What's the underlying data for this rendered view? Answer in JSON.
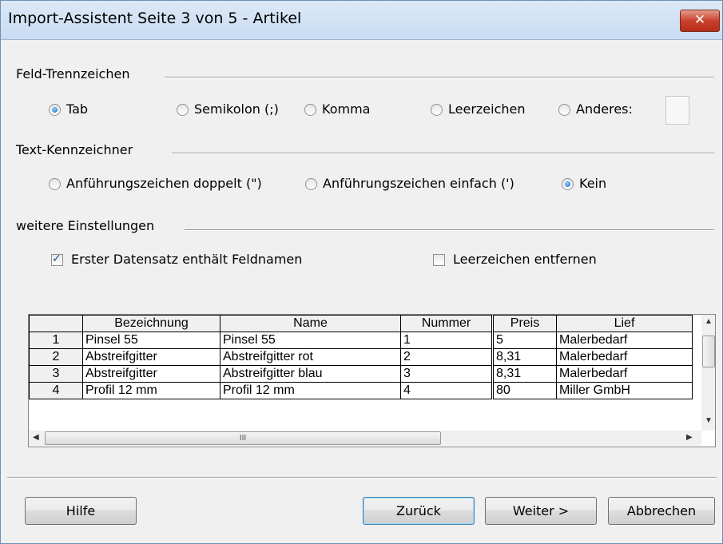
{
  "window": {
    "title": "Import-Assistent Seite 3 von 5 - Artikel",
    "close_icon": "close-icon"
  },
  "field_separator": {
    "label": "Feld-Trennzeichen",
    "options": [
      "Tab",
      "Semikolon (;)",
      "Komma",
      "Leerzeichen",
      "Anderes:"
    ],
    "selected": "Tab",
    "other_value": ""
  },
  "text_qualifier": {
    "label": "Text-Kennzeichner",
    "options": [
      "Anführungszeichen doppelt (\")",
      "Anführungszeichen einfach (')",
      "Kein"
    ],
    "selected": "Kein"
  },
  "more_settings": {
    "label": "weitere Einstellungen",
    "first_row_names": {
      "label": "Erster Datensatz enthält Feldnamen",
      "checked": true
    },
    "trim_spaces": {
      "label": "Leerzeichen entfernen",
      "checked": false
    }
  },
  "preview": {
    "columns": [
      "",
      "Bezeichnung",
      "Name",
      "Nummer",
      "Preis",
      "Lief"
    ],
    "rows": [
      [
        "1",
        "Pinsel 55",
        "Pinsel 55",
        "1",
        "5",
        "Malerbedarf"
      ],
      [
        "2",
        "Abstreifgitter",
        "Abstreifgitter rot",
        "2",
        "8,31",
        "Malerbedarf"
      ],
      [
        "3",
        "Abstreifgitter",
        "Abstreifgitter blau",
        "3",
        "8,31",
        "Malerbedarf"
      ],
      [
        "4",
        "Profil 12 mm",
        "Profil 12 mm",
        "4",
        "80",
        "Miller GmbH"
      ]
    ],
    "hscroll_grip": "III"
  },
  "buttons": {
    "help": "Hilfe",
    "back": "Zurück",
    "next": "Weiter >",
    "cancel": "Abbrechen"
  }
}
